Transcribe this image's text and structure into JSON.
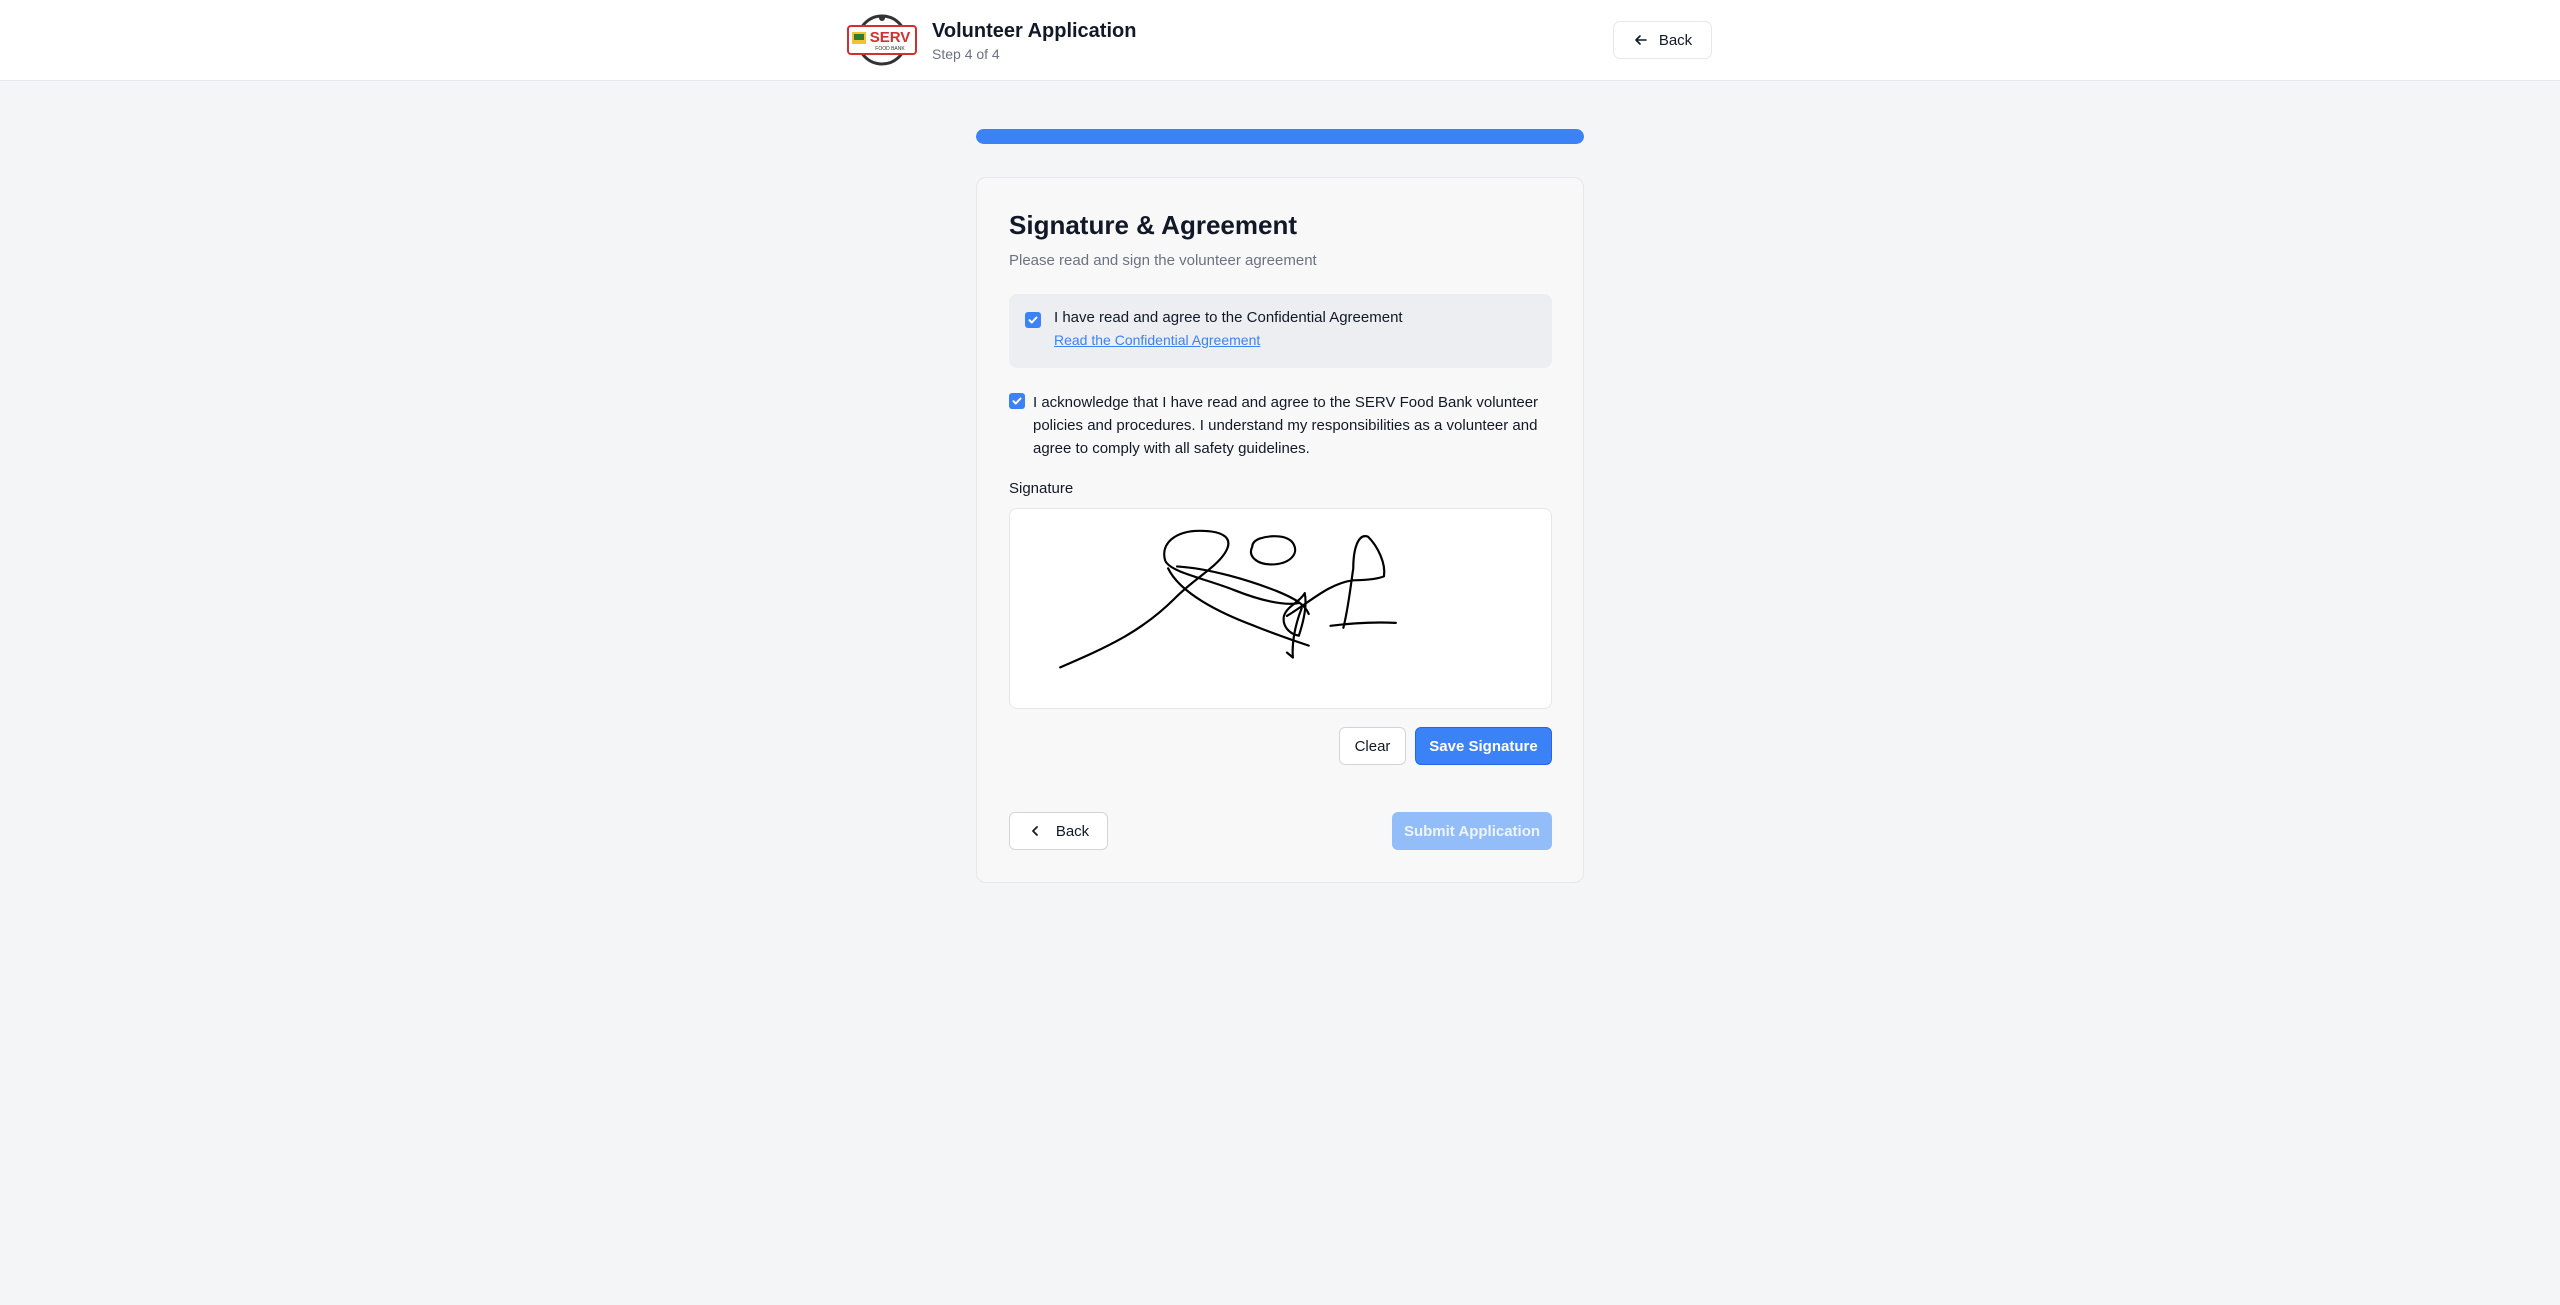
{
  "header": {
    "logo_text": "SERV",
    "logo_subtext": "FOOD BANK",
    "title": "Volunteer Application",
    "step": "Step 4 of 4",
    "back_label": "Back"
  },
  "progress": {
    "current_step": 4,
    "total_steps": 4,
    "fraction": 1.0,
    "color": "#3b82f6"
  },
  "card": {
    "title": "Signature & Agreement",
    "subtitle": "Please read and sign the volunteer agreement",
    "confidential": {
      "checked": true,
      "label": "I have read and agree to the Confidential Agreement",
      "link": "Read the Confidential Agreement"
    },
    "acknowledgement": {
      "checked": true,
      "text": "I acknowledge that I have read and agree to the SERV Food Bank volunteer policies and procedures. I understand my responsibilities as a volunteer and agree to comply with all safety guidelines."
    },
    "signature": {
      "label": "Signature",
      "has_signature": true
    },
    "clear_label": "Clear",
    "save_label": "Save Signature",
    "back_label": "Back",
    "submit_label": "Submit Application",
    "submit_disabled": true
  },
  "icons": {
    "top_back": "arrow-left-icon",
    "form_back": "chevron-left-icon",
    "checkbox": "check-icon"
  },
  "colors": {
    "accent": "#3b82f6",
    "submit_disabled": "#93bdf8",
    "logo_red": "#d32f2f"
  }
}
